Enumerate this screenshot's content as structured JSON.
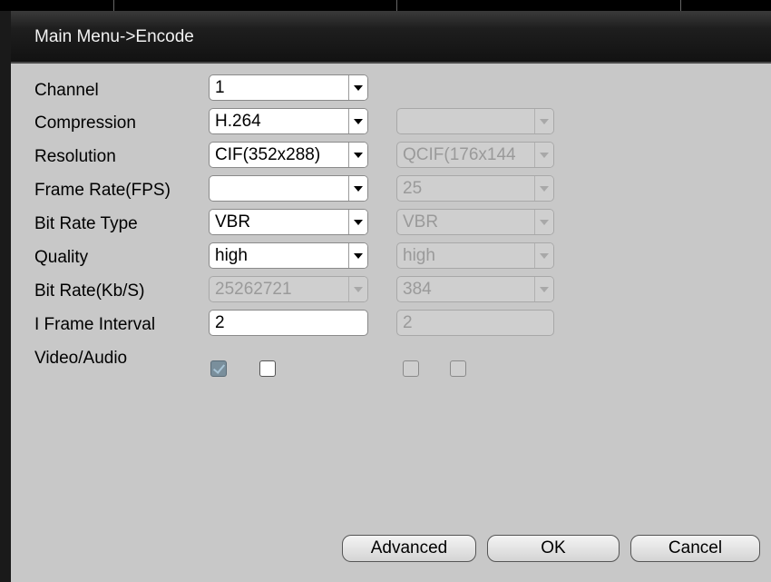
{
  "window": {
    "title": "Main Menu->Encode"
  },
  "rows": [
    {
      "label": "Channel"
    },
    {
      "label": "Compression"
    },
    {
      "label": "Resolution"
    },
    {
      "label": "Frame Rate(FPS)"
    },
    {
      "label": "Bit Rate Type"
    },
    {
      "label": "Quality"
    },
    {
      "label": "Bit Rate(Kb/S)"
    },
    {
      "label": "I Frame Interval"
    },
    {
      "label": "Video/Audio"
    }
  ],
  "main_stream": {
    "channel": "1",
    "compression": "H.264",
    "resolution": "CIF(352x288)",
    "frame_rate": "",
    "bit_rate_type": "VBR",
    "quality": "high",
    "bit_rate": "25262721",
    "i_frame_interval": "2",
    "video_checked": true,
    "audio_checked": false
  },
  "extra_stream": {
    "compression": "",
    "resolution": "QCIF(176x144",
    "frame_rate": "25",
    "bit_rate_type": "VBR",
    "quality": "high",
    "bit_rate": "384",
    "i_frame_interval": "2",
    "video_checked": false,
    "audio_checked": false
  },
  "buttons": {
    "advanced": "Advanced",
    "ok": "OK",
    "cancel": "Cancel"
  }
}
